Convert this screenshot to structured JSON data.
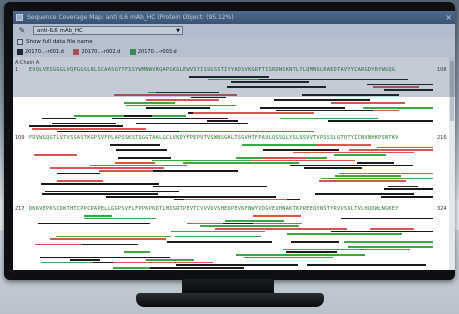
{
  "window": {
    "title": "Sequence Coverage Map: anti IL6 mAb_HC (Protein Object: (95.12%)",
    "close_glyph": "×"
  },
  "toolbar": {
    "selected_protein": "anti-IL6 mAb_HC"
  },
  "options": {
    "show_full_file_name_label": "Show full data file name",
    "show_full_file_name_checked": false
  },
  "legend": [
    {
      "label": "20170...-r001.d",
      "color": "#1a1a1a"
    },
    {
      "label": "20170...-r002.d",
      "color": "#d9534f"
    },
    {
      "label": "20170...-r003.d",
      "color": "#3aa845"
    }
  ],
  "chain_label": "A:Chain A",
  "rows": [
    {
      "start": "1",
      "end": "108",
      "sequence": "EVQLVESGGGLVQPGGSLRLSCAASGYTFSSYWMNWVRQAPGKGLEWVSYISSGSSTIYYADSVKGRFTISRDNSKNTLYLQMNSLRAEDTAVYYCARGDYRYWGQG"
    },
    {
      "start": "109",
      "end": "216",
      "sequence": "FDVWGQGTLVTVSSASTKGPSVFPLAPSSKSTSGGTAALGCLVKDYFPEPVTVSWNSGALTSGVHTFPAVLQSSGLYSLSSVVTVPSSSLGTQTYICNVNHKPSNTKV"
    },
    {
      "start": "217",
      "end": "324",
      "sequence": "DKKVEPKSCDKTHTCPPCPAPELLGGPSVFLFPPKPKDTLMISRTPEVTCVVVDVSHEDPEVKFNWYVDGVEVHNAKTKPREEQYNSTYRVVSVLTVLHQDWLNGKEY"
    }
  ]
}
